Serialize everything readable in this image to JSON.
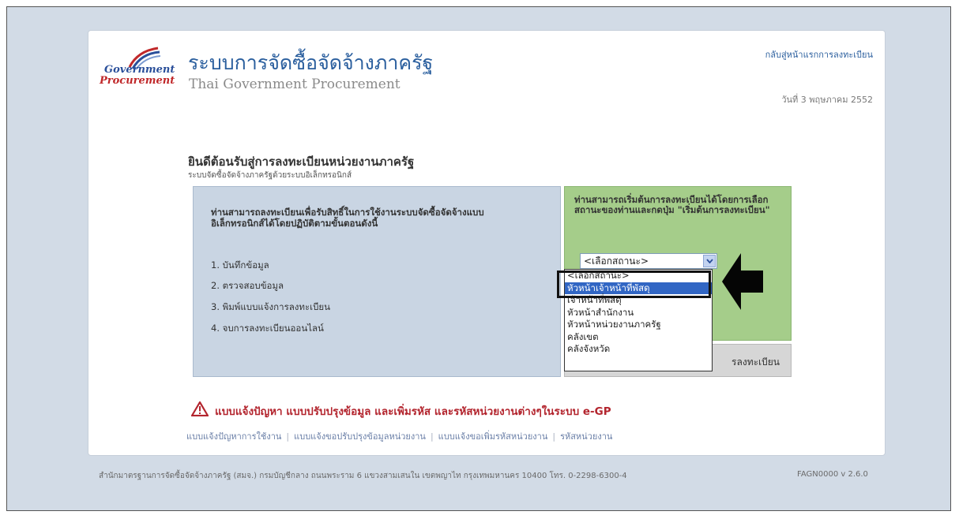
{
  "header": {
    "logo_word1": "Government",
    "logo_word2": "Procurement",
    "title_th": "ระบบการจัดซื้อจัดจ้างภาครัฐ",
    "title_en": "Thai Government Procurement",
    "top_link": "กลับสู่หน้าแรกการลงทะเบียน",
    "date": "วันที่ 3 พฤษภาคม 2552"
  },
  "welcome": {
    "title": "ยินดีต้อนรับสู่การลงทะเบียนหน่วยงานภาครัฐ",
    "subtitle": "ระบบจัดซื้อจัดจ้างภาครัฐด้วยระบบอิเล็กทรอนิกส์"
  },
  "instructions": {
    "intro": "ท่านสามารถลงทะเบียนเพื่อรับสิทธิ์ในการใช้งานระบบจัดซื้อจัดจ้างแบบอิเล็กทรอนิกส์ได้โดยปฏิบัติตามขั้นตอนดังนี้",
    "steps": [
      "1. บันทึกข้อมูล",
      "2. ตรวจสอบข้อมูล",
      "3. พิมพ์แบบแจ้งการลงทะเบียน",
      "4. จบการลงทะเบียนออนไลน์"
    ]
  },
  "start_panel": {
    "text": "ท่านสามารถเริ่มต้นการลงทะเบียนได้โดยการเลือกสถานะของท่านและกดปุ่ม \"เริ่มต้นการลงทะเบียน\"",
    "select_value": "<เลือกสถานะ>",
    "options": [
      "<เลือกสถานะ>",
      "หัวหน้าเจ้าหน้าที่พัสดุ",
      "เจ้าหน้าที่พัสดุ",
      "หัวหน้าสำนักงาน",
      "หัวหน้าหน่วยงานภาครัฐ",
      "คลังเขต",
      "คลังจังหวัด"
    ],
    "highlighted_index": 1,
    "button_label": "รลงทะเบียน"
  },
  "warning": {
    "text": "แบบแจ้งปัญหา แบบปรับปรุงข้อมูล และเพิ่มรหัส และรหัสหน่วยงานต่างๆในระบบ e-GP",
    "links": [
      "แบบแจ้งปัญหาการใช้งาน",
      "แบบแจ้งขอปรับปรุงข้อมูลหน่วยงาน",
      "แบบแจ้งขอเพิ่มรหัสหน่วยงาน",
      "รหัสหน่วยงาน"
    ]
  },
  "footer": {
    "address": "สำนักมาตรฐานการจัดซื้อจัดจ้างภาครัฐ (สมจ.) กรมบัญชีกลาง ถนนพระราม 6 แขวงสามเสนใน เขตพญาไท กรุงเทพมหานคร 10400 โทร. 0-2298-6300-4",
    "version": "FAGN0000 v 2.6.0"
  },
  "colors": {
    "brand_blue": "#2b5f9e",
    "brand_red": "#c0282a",
    "panel_blue": "#c9d5e3",
    "panel_green": "#a5cd8a",
    "highlight": "#3166c4"
  }
}
